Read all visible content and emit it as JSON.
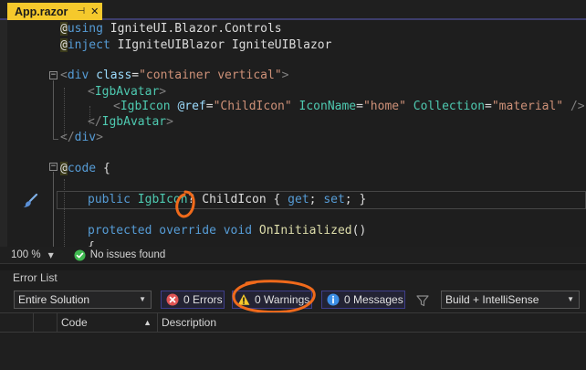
{
  "tab": {
    "title": "App.razor",
    "pin_glyph": "⊣",
    "close_glyph": "✕"
  },
  "code": {
    "l1": {
      "at": "@",
      "kw": "using",
      "rest": " IgniteUI.Blazor.Controls"
    },
    "l2": {
      "at": "@",
      "kw": "inject",
      "rest": " IIgniteUIBlazor IgniteUIBlazor"
    },
    "l4": {
      "open": "<",
      "tag": "div",
      "attr": " class",
      "eq": "=",
      "val": "\"container vertical\"",
      "close": ">"
    },
    "l5": {
      "open": "<",
      "tag": "IgbAvatar",
      "close": ">"
    },
    "l6": {
      "open": "<",
      "tag": "IgbIcon",
      "ref_at": " @",
      "ref_attr": "ref",
      "eq1": "=",
      "ref_val": "\"ChildIcon\"",
      "a2": " IconName",
      "eq2": "=",
      "v2": "\"home\"",
      "a3": " Collection",
      "eq3": "=",
      "v3": "\"material\"",
      "end": " />"
    },
    "l7": {
      "open": "</",
      "tag": "IgbAvatar",
      "close": ">"
    },
    "l8": {
      "open": "</",
      "tag": "div",
      "close": ">"
    },
    "l10": {
      "at": "@",
      "kw": "code",
      "rest": " {"
    },
    "l12": {
      "kw": "public",
      "type": " IgbIcon",
      "rest": "? ChildIcon { ",
      "get": "get",
      "semi1": "; ",
      "set": "set",
      "end": "; }"
    },
    "l14": {
      "kw1": "protected",
      "kw2": " override",
      "kw3": " void",
      "method": " OnInitialized",
      "rest": "()"
    },
    "l15": {
      "rest": "{"
    }
  },
  "status": {
    "zoom": "100 %",
    "issues": "No issues found"
  },
  "error_list": {
    "title": "Error List",
    "scope": "Entire Solution",
    "errors": "0 Errors",
    "warnings": "0 Warnings",
    "messages": "0 Messages",
    "build_filter": "Build + IntelliSense",
    "columns": {
      "code": "Code",
      "description": "Description"
    }
  },
  "colors": {
    "tab_active": "#f5c92c",
    "annotation": "#f06a1b",
    "warning": "#f5c92c",
    "error": "#e05454",
    "info": "#3c8fe6",
    "ok": "#3fb950"
  }
}
